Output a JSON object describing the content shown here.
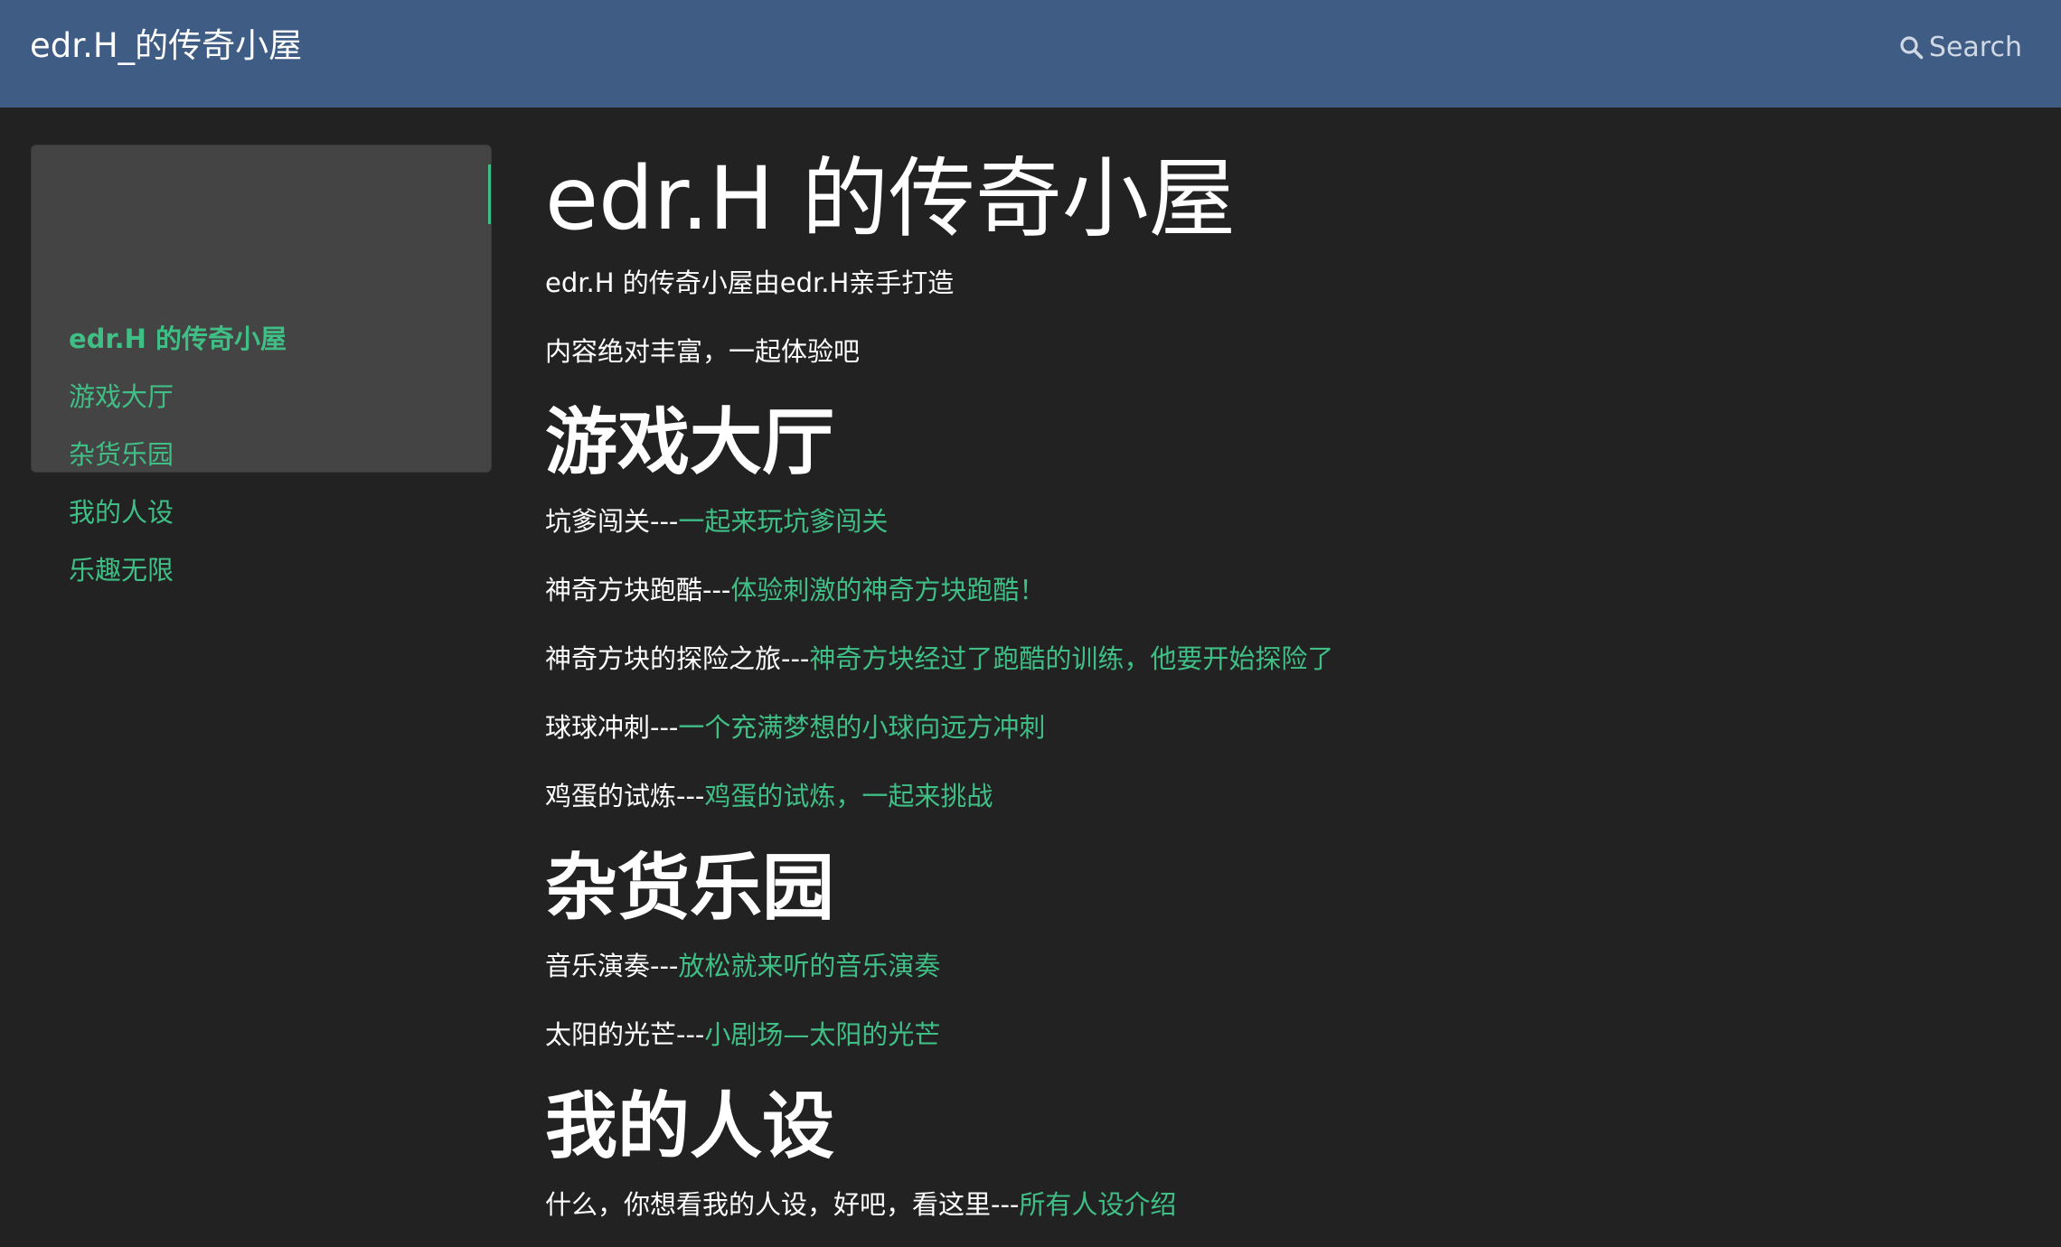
{
  "header": {
    "brand": "edr.H_的传奇小屋",
    "search_label": "Search"
  },
  "sidebar": {
    "items": [
      {
        "label": "edr.H 的传奇小屋",
        "active": true
      },
      {
        "label": "游戏大厅"
      },
      {
        "label": "杂货乐园"
      },
      {
        "label": "我的人设"
      },
      {
        "label": "乐趣无限"
      }
    ]
  },
  "main": {
    "title": "edr.H 的传奇小屋",
    "intro": [
      "edr.H 的传奇小屋由edr.H亲手打造",
      "内容绝对丰富，一起体验吧"
    ],
    "sections": [
      {
        "heading": "游戏大厅",
        "entries": [
          {
            "name": "坑爹闯关---",
            "link": "一起来玩坑爹闯关"
          },
          {
            "name": "神奇方块跑酷---",
            "link": "体验刺激的神奇方块跑酷！"
          },
          {
            "name": "神奇方块的探险之旅---",
            "link": "神奇方块经过了跑酷的训练，他要开始探险了"
          },
          {
            "name": "球球冲刺---",
            "link": "一个充满梦想的小球向远方冲刺"
          },
          {
            "name": "鸡蛋的试炼---",
            "link": "鸡蛋的试炼，一起来挑战"
          }
        ]
      },
      {
        "heading": "杂货乐园",
        "entries": [
          {
            "name": "音乐演奏---",
            "link": "放松就来听的音乐演奏"
          },
          {
            "name": "太阳的光芒---",
            "link": "小剧场—太阳的光芒"
          }
        ]
      },
      {
        "heading": "我的人设",
        "entries": [
          {
            "name": "什么，你想看我的人设，好吧，看这里---",
            "link": "所有人设介绍"
          }
        ]
      }
    ]
  },
  "colors": {
    "header_bg": "#3f5c84",
    "page_bg": "#222222",
    "sidebar_bg": "#444444",
    "link": "#3fbf85",
    "text": "#ffffff"
  }
}
